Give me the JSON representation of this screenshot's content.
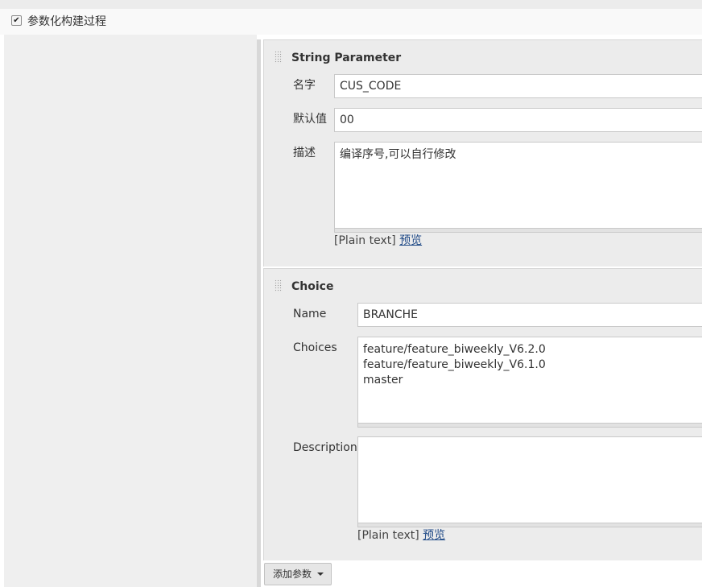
{
  "section": {
    "checkbox_checked": true,
    "label": "参数化构建过程"
  },
  "string_parameter": {
    "title": "String Parameter",
    "name_label": "名字",
    "name_value": "CUS_CODE",
    "default_label": "默认值",
    "default_value": "00",
    "desc_label": "描述",
    "desc_value": "编译序号,可以自行修改",
    "hint_text": "[Plain text]",
    "preview_link": "预览"
  },
  "choice": {
    "title": "Choice",
    "name_label": "Name",
    "name_value": "BRANCHE",
    "choices_label": "Choices",
    "choices": [
      "feature/feature_biweekly_V6.2.0",
      "feature/feature_biweekly_V6.1.0",
      "master"
    ],
    "desc_label": "Description",
    "desc_value": "",
    "hint_text": "[Plain text]",
    "preview_link": "预览"
  },
  "add_param_button": {
    "label": "添加参数",
    "icon": "caret-down-icon"
  }
}
